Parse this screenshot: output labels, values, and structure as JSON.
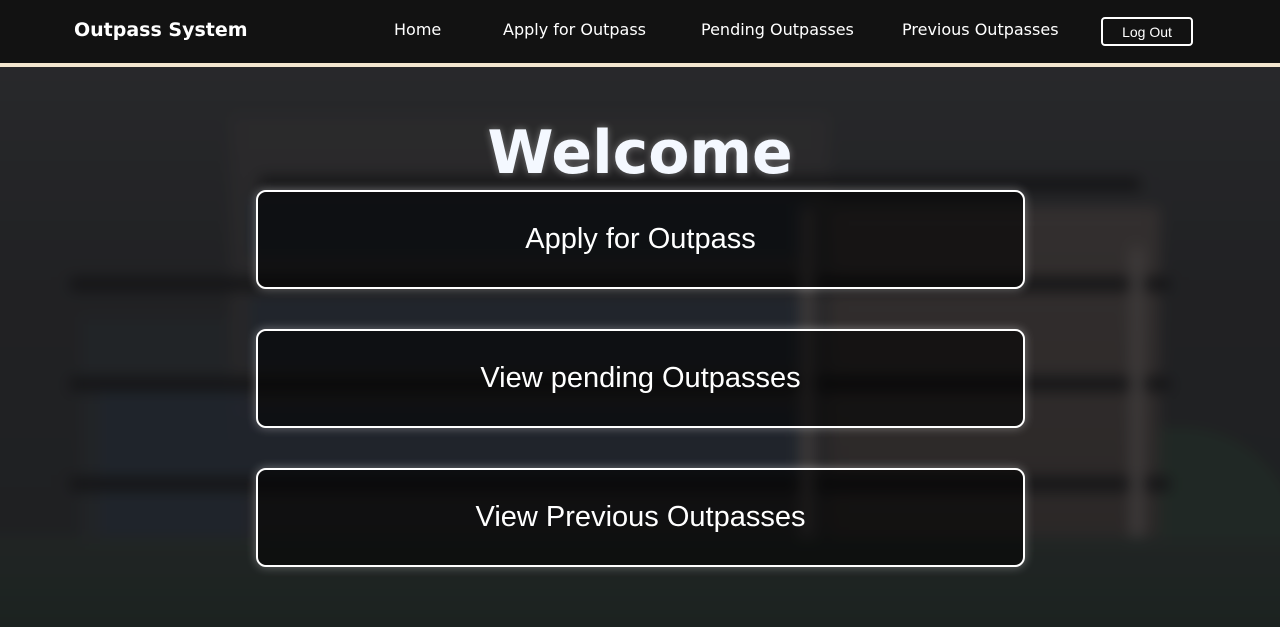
{
  "navbar": {
    "brand": "Outpass System",
    "links": [
      {
        "label": "Home"
      },
      {
        "label": "Apply for Outpass"
      },
      {
        "label": "Pending Outpasses"
      },
      {
        "label": "Previous Outpasses"
      }
    ],
    "logout_label": "Log Out"
  },
  "main": {
    "heading": "Welcome",
    "actions": [
      {
        "label": "Apply for Outpass"
      },
      {
        "label": "View pending Outpasses"
      },
      {
        "label": "View Previous Outpasses"
      }
    ]
  },
  "colors": {
    "navbar_bg": "#121212",
    "nav_accent": "#f3e6cf",
    "text": "#ffffff"
  }
}
